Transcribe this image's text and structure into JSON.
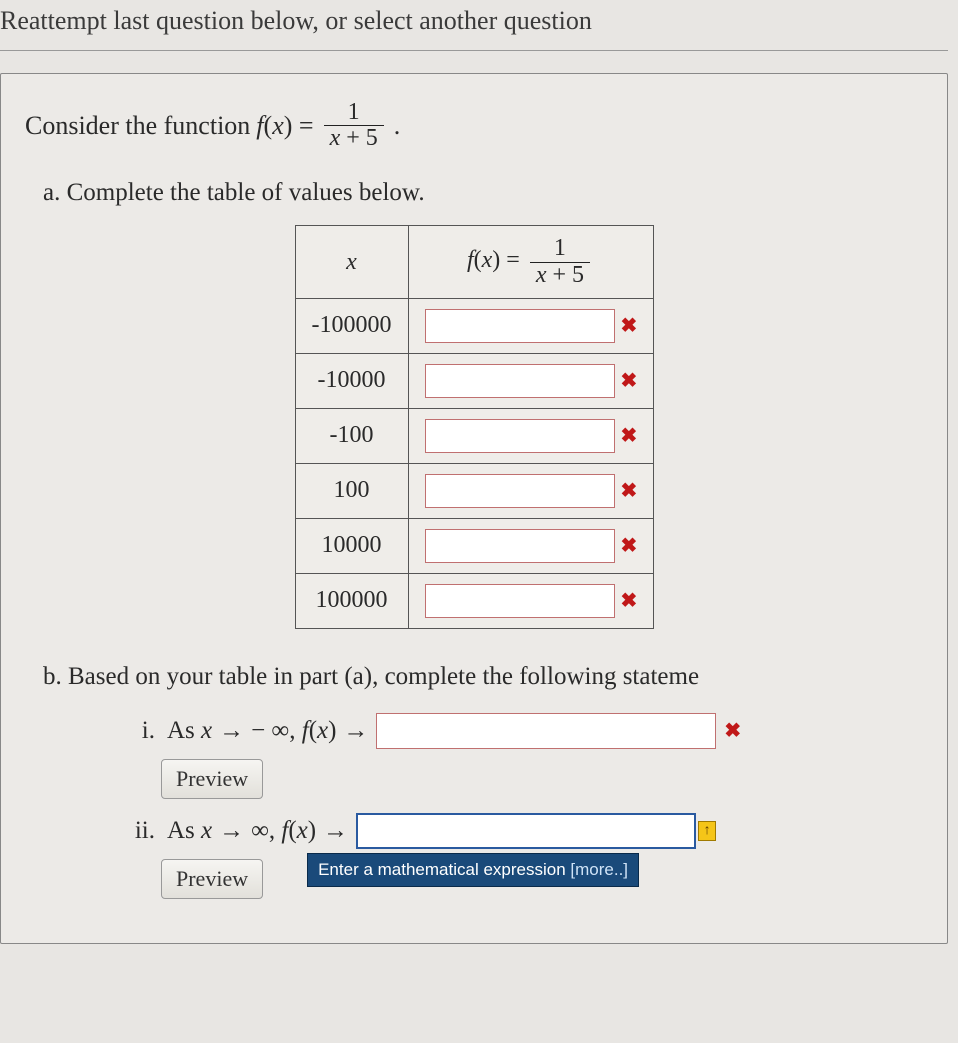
{
  "instruction": "Reattempt last question below, or select another question",
  "question": {
    "intro_prefix": "Consider the function ",
    "func_lhs": "f(x) = ",
    "frac_num": "1",
    "frac_den_var": "x",
    "frac_den_rest": " + 5",
    "period": "."
  },
  "part_a": {
    "label": "a. Complete the table of values below.",
    "col1_header_var": "x",
    "col2_header_lhs": "f(x) = ",
    "col2_frac_num": "1",
    "col2_frac_den_var": "x",
    "col2_frac_den_rest": " + 5",
    "rows": [
      {
        "x": "-100000",
        "val": "",
        "wrong": true
      },
      {
        "x": "-10000",
        "val": "",
        "wrong": true
      },
      {
        "x": "-100",
        "val": "",
        "wrong": true
      },
      {
        "x": "100",
        "val": "",
        "wrong": true
      },
      {
        "x": "10000",
        "val": "",
        "wrong": true
      },
      {
        "x": "100000",
        "val": "",
        "wrong": true
      }
    ]
  },
  "part_b": {
    "label": "b. Based on your table in part (a), complete the following stateme",
    "items": [
      {
        "roman": "i.",
        "text_prefix": "As ",
        "var": "x",
        "arrow1": " → ",
        "limit_to": " − ∞, ",
        "func": "f(x)",
        "arrow2": " → ",
        "value": "",
        "wrong": true,
        "preview": "Preview"
      },
      {
        "roman": "ii.",
        "text_prefix": "As ",
        "var": "x",
        "arrow1": " → ",
        "limit_to": "∞, ",
        "func": "f(x)",
        "arrow2": " → ",
        "value": "",
        "focused": true,
        "preview": "Preview"
      }
    ]
  },
  "tooltip": {
    "text": "Enter a mathematical expression ",
    "more": "[more..]"
  },
  "icons": {
    "wrong": "✖",
    "caret": "↑"
  }
}
